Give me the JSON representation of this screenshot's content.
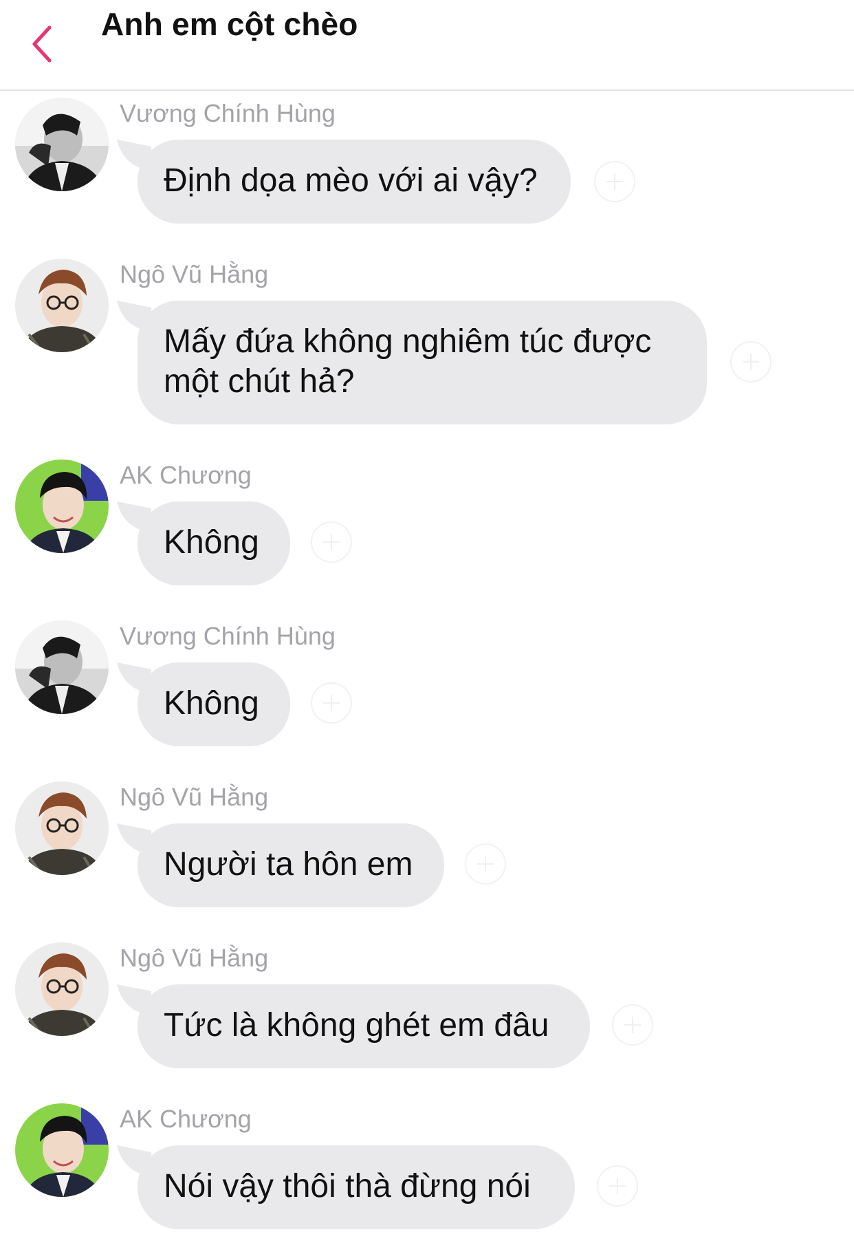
{
  "header": {
    "title": "Anh em cột chèo",
    "accent_color": "#e8356f"
  },
  "messages": [
    {
      "sender": "Vương Chính Hùng",
      "avatar": "avatar-vuong-chinh-hung",
      "text": "Định dọa mèo với ai vậy?"
    },
    {
      "sender": "Ngô Vũ Hằng",
      "avatar": "avatar-ngo-vu-hang",
      "text": "Mấy đứa không nghiêm túc được\nmột chút hả?"
    },
    {
      "sender": "AK Chương",
      "avatar": "avatar-ak-chuong",
      "text": "Không"
    },
    {
      "sender": "Vương Chính Hùng",
      "avatar": "avatar-vuong-chinh-hung",
      "text": "Không"
    },
    {
      "sender": "Ngô Vũ Hằng",
      "avatar": "avatar-ngo-vu-hang",
      "text": "Người ta hôn em"
    },
    {
      "sender": "Ngô Vũ Hằng",
      "avatar": "avatar-ngo-vu-hang",
      "text": "Tức là không ghét em đâu"
    },
    {
      "sender": "AK Chương",
      "avatar": "avatar-ak-chuong",
      "text": "Nói vậy thôi thà đừng nói"
    }
  ],
  "bubble_color": "#e9e9eb",
  "sender_color": "#a3a3a8"
}
